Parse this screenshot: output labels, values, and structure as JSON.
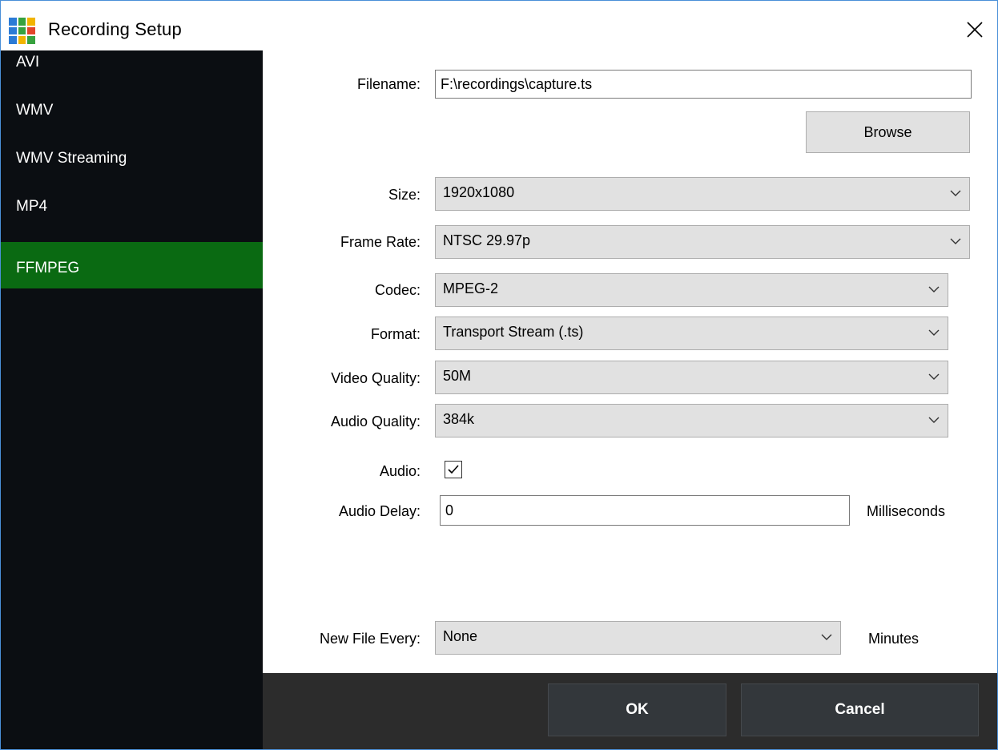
{
  "window": {
    "title": "Recording Setup",
    "close_icon": "close-icon",
    "app_icon_colors": [
      "#2b7bd6",
      "#37a23f",
      "#f2b400",
      "#2b7bd6",
      "#37a23f",
      "#e2452b",
      "#2b7bd6",
      "#f2b400",
      "#37a23f"
    ]
  },
  "sidebar": {
    "items": [
      {
        "label": "AVI",
        "active": false
      },
      {
        "label": "WMV",
        "active": false
      },
      {
        "label": "WMV Streaming",
        "active": false
      },
      {
        "label": "MP4",
        "active": false
      },
      {
        "label": "FFMPEG",
        "active": true
      }
    ],
    "active_color": "#0a6a12"
  },
  "form": {
    "filename": {
      "label": "Filename:",
      "value": "F:\\recordings\\capture.ts"
    },
    "browse_label": "Browse",
    "size": {
      "label": "Size:",
      "value": "1920x1080"
    },
    "frame_rate": {
      "label": "Frame Rate:",
      "value": "NTSC 29.97p"
    },
    "codec": {
      "label": "Codec:",
      "value": "MPEG-2"
    },
    "format": {
      "label": "Format:",
      "value": "Transport Stream (.ts)"
    },
    "video_quality": {
      "label": "Video Quality:",
      "value": "50M"
    },
    "audio_quality": {
      "label": "Audio Quality:",
      "value": "384k"
    },
    "audio": {
      "label": "Audio:",
      "checked": true
    },
    "audio_delay": {
      "label": "Audio Delay:",
      "value": "0",
      "unit": "Milliseconds"
    },
    "new_file_every": {
      "label": "New File Every:",
      "value": "None",
      "unit": "Minutes"
    }
  },
  "footer": {
    "ok_label": "OK",
    "cancel_label": "Cancel"
  }
}
